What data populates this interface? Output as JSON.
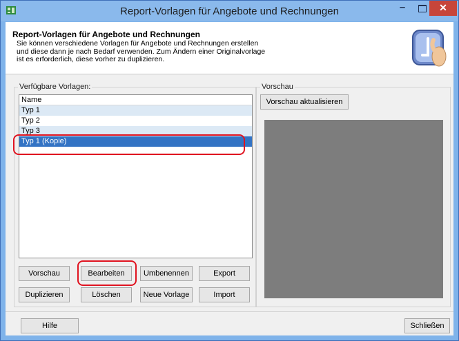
{
  "window": {
    "title": "Report-Vorlagen für Angebote und Rechnungen",
    "controls": {
      "minimize": "–",
      "close": "✕"
    }
  },
  "header": {
    "title": "Report-Vorlagen für Angebote und Rechnungen",
    "description": "Sie können verschiedene Vorlagen für Angebote und Rechnungen erstellen\nund diese dann je nach Bedarf verwenden. Zum Ändern einer Originalvorlage\nist es erforderlich, diese vorher zu duplizieren.",
    "icon": "template-editor-icon"
  },
  "templates": {
    "group_label": "Verfügbare Vorlagen:",
    "column_header": "Name",
    "items": [
      {
        "label": "Typ 1",
        "selected": false
      },
      {
        "label": "Typ 2",
        "selected": false
      },
      {
        "label": "Typ 3",
        "selected": false
      },
      {
        "label": "Typ 1 (Kopie)",
        "selected": true
      }
    ]
  },
  "actions": {
    "preview": "Vorschau",
    "edit": "Bearbeiten",
    "rename": "Umbenennen",
    "export": "Export",
    "duplicate": "Duplizieren",
    "delete": "Löschen",
    "new_template": "Neue Vorlage",
    "import": "Import"
  },
  "preview": {
    "group_label": "Vorschau",
    "refresh_button": "Vorschau aktualisieren"
  },
  "footer": {
    "help_button": "Hilfe",
    "close_button": "Schließen"
  },
  "colors": {
    "titlebar": "#8ab9ec",
    "selection": "#3373c4",
    "alt_row": "#dce9f5",
    "highlight": "#e0121f",
    "close_button": "#c7453a"
  }
}
